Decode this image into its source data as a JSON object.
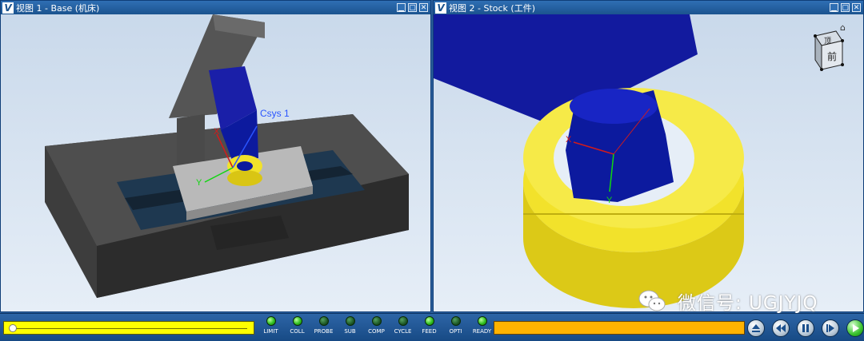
{
  "views": [
    {
      "title": "视图 1 - Base (机床)",
      "logo": "V",
      "controls": [
        "minimize-icon",
        "restore-icon",
        "close-icon"
      ]
    },
    {
      "title": "视图 2 - Stock (工件)",
      "logo": "V",
      "controls": [
        "minimize-icon",
        "restore-icon",
        "close-icon"
      ]
    }
  ],
  "scene1": {
    "csys_label": "Csys 1",
    "x_label": "X",
    "y_label": "Y",
    "z_label": "Z"
  },
  "scene2": {
    "x_label": "X",
    "y_label": "Y",
    "viewcube_top": "顶",
    "viewcube_front": "前"
  },
  "watermark": "微信号: UGJYJQ",
  "status_lights": [
    {
      "label": "LIMIT",
      "on": true
    },
    {
      "label": "COLL",
      "on": true
    },
    {
      "label": "PROBE",
      "on": false
    },
    {
      "label": "SUB",
      "on": false
    },
    {
      "label": "COMP",
      "on": false
    },
    {
      "label": "CYCLE",
      "on": false
    },
    {
      "label": "FEED",
      "on": true
    },
    {
      "label": "OPTI",
      "on": false
    },
    {
      "label": "READY",
      "on": true
    }
  ],
  "sim_slider_position": 0.02,
  "controls": [
    "eject-icon",
    "rewind-icon",
    "pause-icon",
    "step-forward-icon",
    "play-icon"
  ],
  "colors": {
    "slider": "#ffff00",
    "progress": "#ffb300",
    "stock": "#f2e22b",
    "tool": "#0c1a9e",
    "machine_bed": "#4a4a4a"
  }
}
